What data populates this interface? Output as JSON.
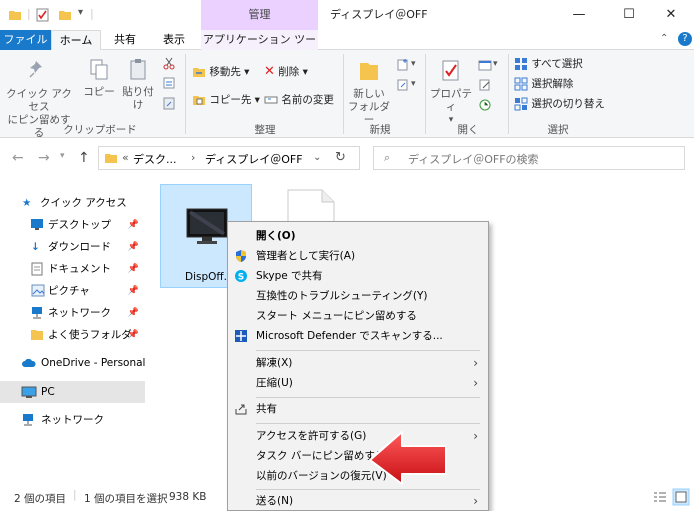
{
  "window": {
    "title": "ディスプレイ＠OFF",
    "context_tab_group": "管理",
    "minimize": "—",
    "maximize": "☐",
    "close": "✕"
  },
  "tabs": {
    "file": "ファイル",
    "home": "ホーム",
    "share": "共有",
    "view": "表示",
    "app_tools": "アプリケーション ツール",
    "help": "?"
  },
  "ribbon": {
    "clipboard": {
      "pin_quick_access": "クイック アクセス\nにピン留めする",
      "copy": "コピー",
      "paste": "貼り付け",
      "group_label": "クリップボード"
    },
    "organize": {
      "move_to": "移動先",
      "copy_to": "コピー先",
      "delete": "削除",
      "rename": "名前の変更",
      "group_label": "整理"
    },
    "new": {
      "new_folder": "新しい\nフォルダー",
      "group_label": "新規"
    },
    "open": {
      "properties": "プロパティ",
      "group_label": "開く"
    },
    "select": {
      "select_all": "すべて選択",
      "select_none": "選択解除",
      "invert_selection": "選択の切り替え",
      "group_label": "選択"
    }
  },
  "navbar": {
    "back": "←",
    "forward": "→",
    "up": "↑",
    "breadcrumb_prefix": "«",
    "breadcrumb_1": "デスク...",
    "breadcrumb_sep": "›",
    "breadcrumb_2": "ディスプレイ＠OFF",
    "search_placeholder": "ディスプレイ＠OFFの検索"
  },
  "sidebar": {
    "items": [
      {
        "label": "クイック アクセス"
      },
      {
        "label": "デスクトップ"
      },
      {
        "label": "ダウンロード"
      },
      {
        "label": "ドキュメント"
      },
      {
        "label": "ピクチャ"
      },
      {
        "label": "ネットワーク"
      },
      {
        "label": "よく使うフォルダ"
      },
      {
        "label": "OneDrive - Personal"
      },
      {
        "label": "PC"
      },
      {
        "label": "ネットワーク"
      }
    ]
  },
  "files": {
    "selected_name": "DispOff.e"
  },
  "status": {
    "item_count": "2 個の項目",
    "selected": "1 個の項目を選択",
    "size": "938 KB"
  },
  "context_menu": {
    "items": [
      {
        "label": "開く(O)"
      },
      {
        "label": "管理者として実行(A)"
      },
      {
        "label": "Skype で共有"
      },
      {
        "label": "互換性のトラブルシューティング(Y)"
      },
      {
        "label": "スタート メニューにピン留めする"
      },
      {
        "label": "Microsoft Defender でスキャンする..."
      },
      {
        "label": "解凍(X)"
      },
      {
        "label": "圧縮(U)"
      },
      {
        "label": "共有"
      },
      {
        "label": "アクセスを許可する(G)"
      },
      {
        "label": "タスク バーにピン留めする(K)"
      },
      {
        "label": "以前のバージョンの復元(V)"
      },
      {
        "label": "送る(N)"
      }
    ],
    "submenu_arrow": "›"
  },
  "colors": {
    "accent": "#1979ca",
    "context_tab": "#ead1ff",
    "selection": "#cce8ff",
    "arrow_red": "#e0161e"
  }
}
